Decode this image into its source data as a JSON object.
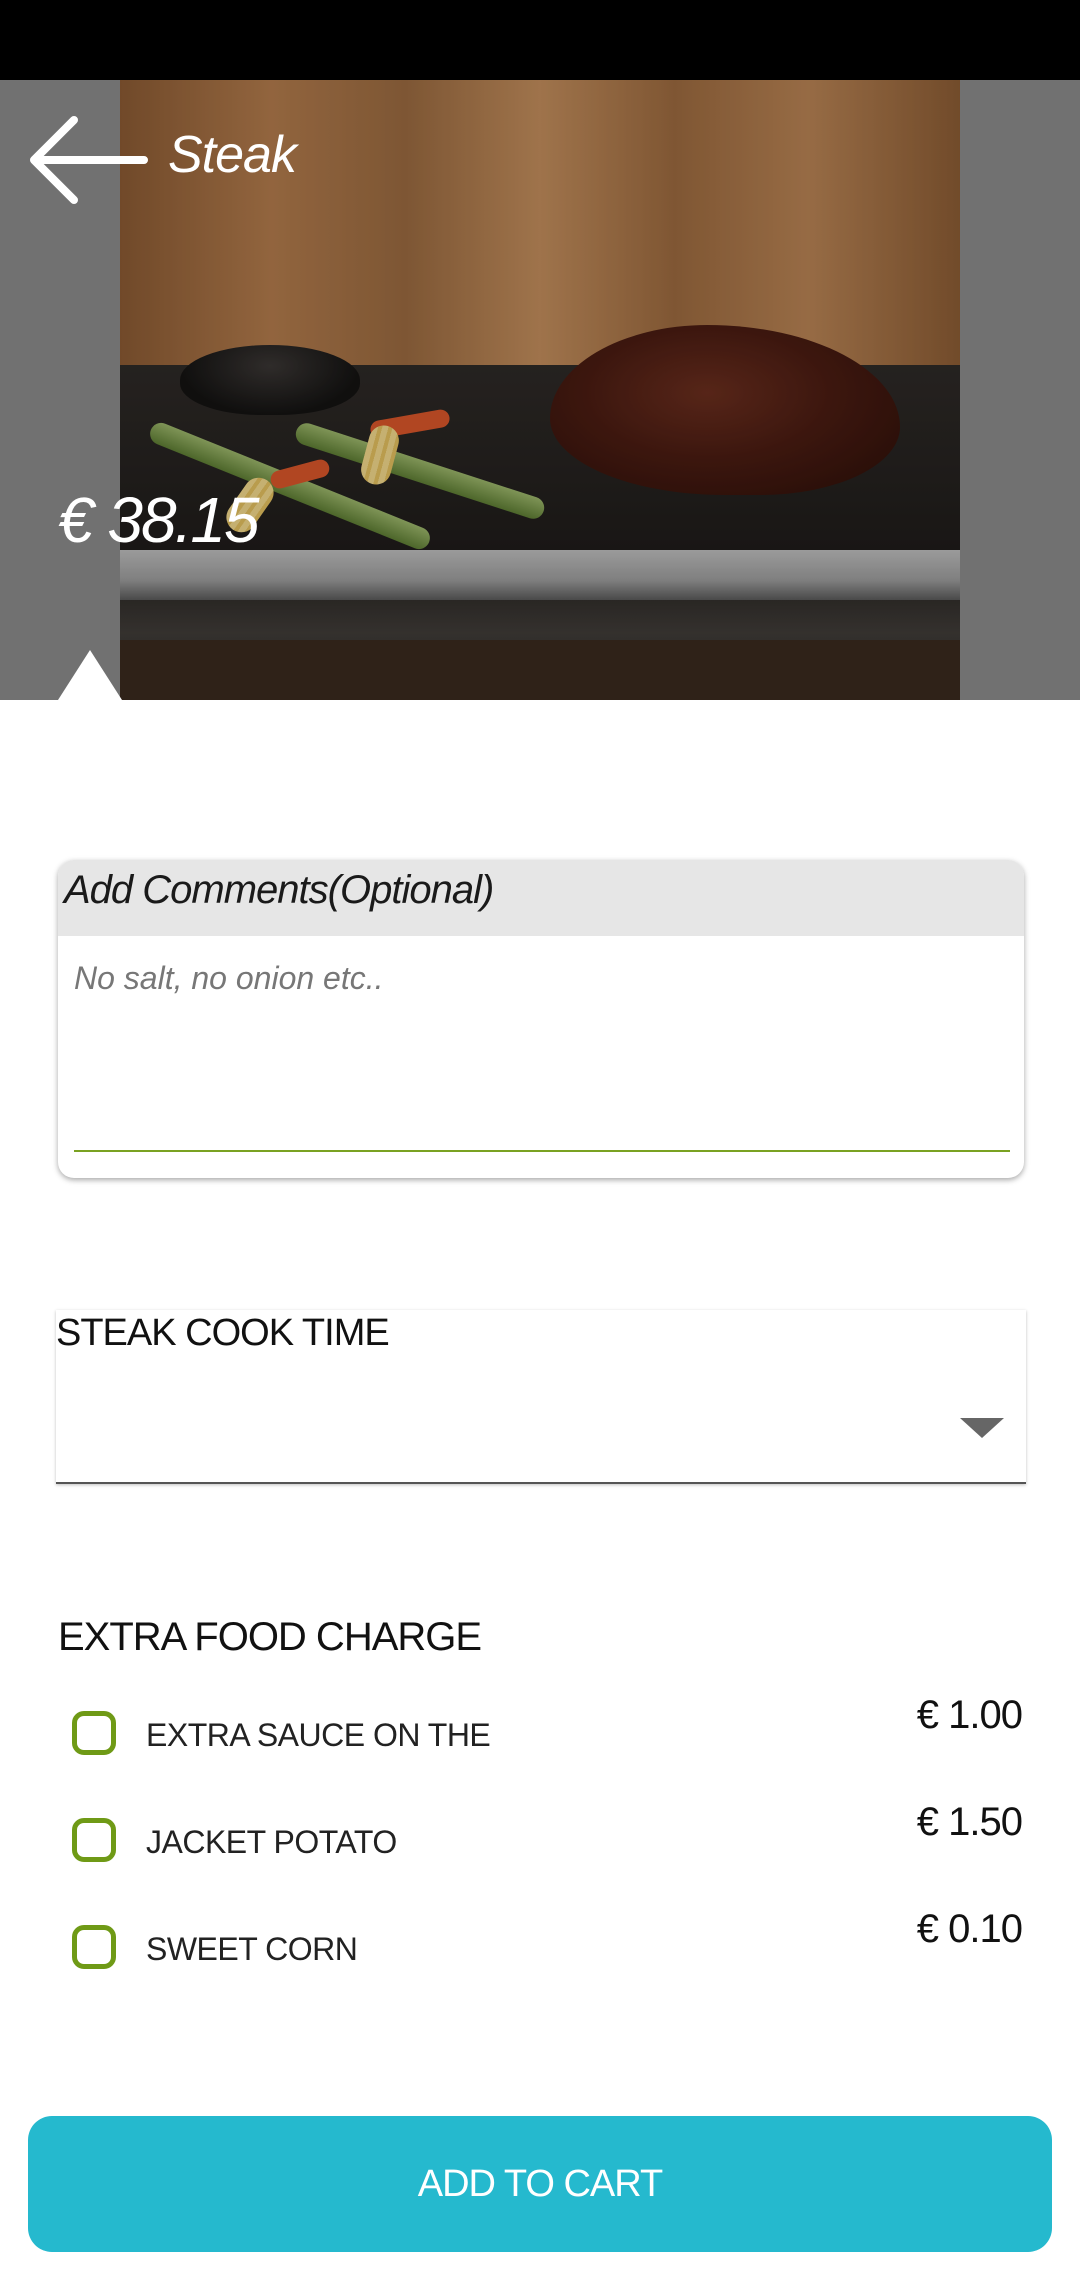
{
  "header": {
    "title": "Steak",
    "price": "€ 38.15",
    "back_icon": "arrow-left-icon"
  },
  "comments": {
    "header_label": "Add Comments(Optional)",
    "placeholder": "No salt, no onion etc..",
    "value": "",
    "underline_color": "#7aa222"
  },
  "cook_time": {
    "label": "STEAK COOK TIME",
    "selected_value": "",
    "dropdown_icon": "caret-down-icon"
  },
  "extras": {
    "title": "EXTRA FOOD CHARGE",
    "items": [
      {
        "label": "EXTRA SAUCE ON THE",
        "price": "€ 1.00",
        "checked": false
      },
      {
        "label": "JACKET POTATO",
        "price": "€ 1.50",
        "checked": false
      },
      {
        "label": "SWEET CORN",
        "price": "€ 0.10",
        "checked": false
      }
    ],
    "checkbox_color": "#6f9a16"
  },
  "cart": {
    "button_label": "ADD TO CART",
    "button_color": "#25b9ce"
  }
}
